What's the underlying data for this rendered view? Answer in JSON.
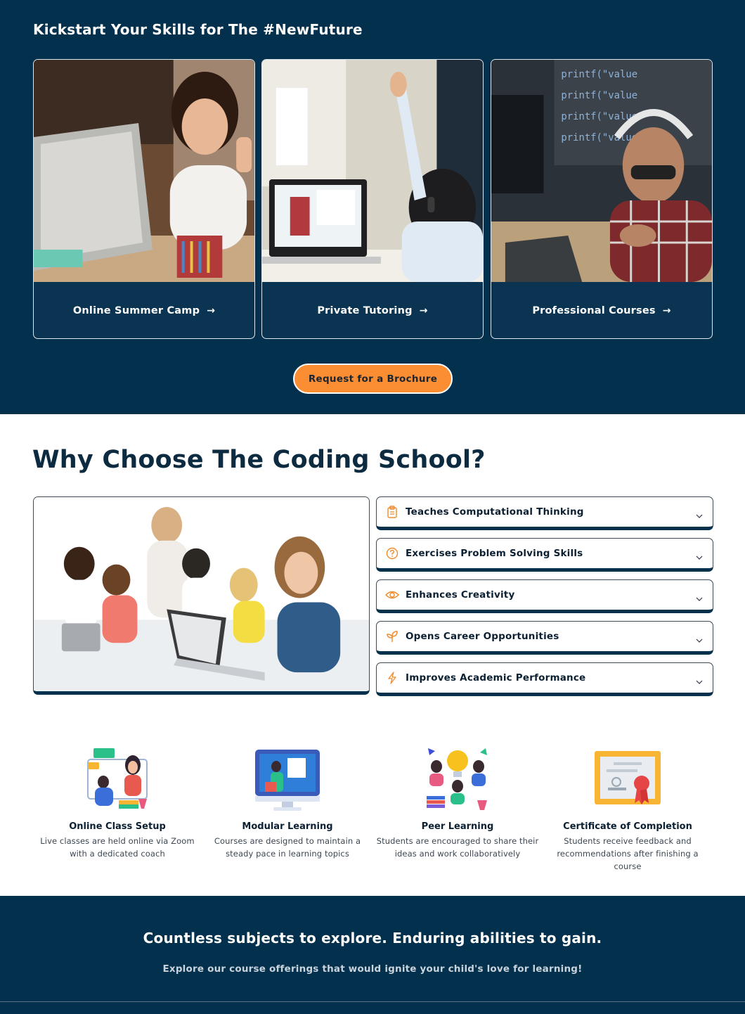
{
  "top": {
    "title": "Kickstart Your Skills for The #NewFuture",
    "cards": [
      {
        "label": "Online Summer Camp",
        "arrow": "→"
      },
      {
        "label": "Private Tutoring",
        "arrow": "→"
      },
      {
        "label": "Professional Courses",
        "arrow": "→"
      }
    ],
    "brochure_button": "Request for a Brochure"
  },
  "why": {
    "title": "Why Choose The Coding School?",
    "accordion": [
      {
        "label": "Teaches Computational Thinking",
        "icon": "clipboard-icon"
      },
      {
        "label": "Exercises Problem Solving Skills",
        "icon": "question-circle-icon"
      },
      {
        "label": "Enhances Creativity",
        "icon": "eye-icon"
      },
      {
        "label": "Opens Career Opportunities",
        "icon": "sprout-icon"
      },
      {
        "label": "Improves Academic Performance",
        "icon": "lightning-icon"
      }
    ]
  },
  "features": [
    {
      "title": "Online Class Setup",
      "desc": "Live classes are held online via Zoom with a dedicated coach",
      "icon": "online-class-illustration"
    },
    {
      "title": "Modular Learning",
      "desc": "Courses are designed to maintain a steady pace in learning topics",
      "icon": "modular-learning-illustration"
    },
    {
      "title": "Peer Learning",
      "desc": "Students are encouraged to share their ideas and work collaboratively",
      "icon": "peer-learning-illustration"
    },
    {
      "title": "Certificate of Completion",
      "desc": "Students receive feedback and recommendations after finishing a course",
      "icon": "certificate-illustration"
    }
  ],
  "bottom": {
    "title": "Countless subjects to explore. Enduring abilities to gain.",
    "subtitle": "Explore our course offerings that would ignite your child's love for learning!"
  },
  "colors": {
    "navy": "#03304d",
    "orange": "#fb8d33",
    "icon_orange": "#f08a2b"
  }
}
